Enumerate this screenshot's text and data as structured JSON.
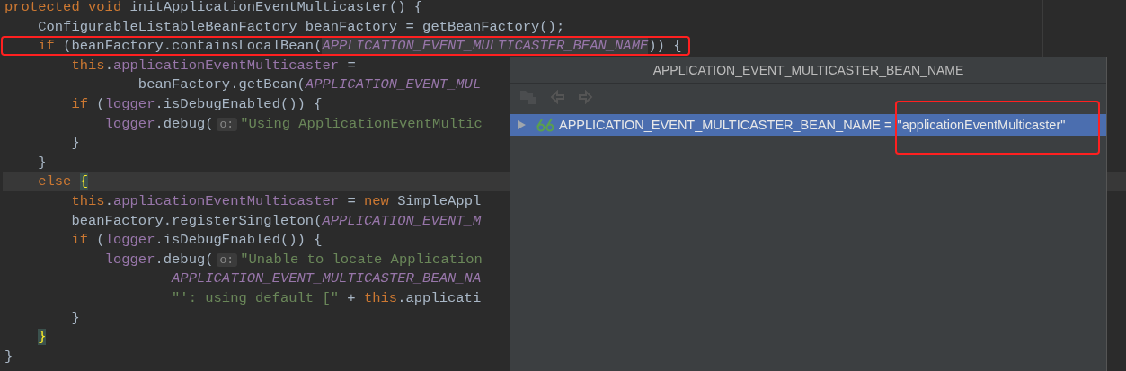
{
  "editor": {
    "lines": [
      {
        "current": false,
        "outlined": false,
        "tokens": [
          {
            "kind": "keyword",
            "text": "protected void "
          },
          {
            "kind": "plain",
            "text": "initApplicationEventMulticaster() {"
          }
        ]
      },
      {
        "current": false,
        "outlined": false,
        "tokens": [
          {
            "kind": "plain",
            "text": "    ConfigurableListableBeanFactory beanFactory = getBeanFactory();"
          }
        ]
      },
      {
        "current": false,
        "outlined": true,
        "tokens": [
          {
            "kind": "keyword",
            "text": "    if "
          },
          {
            "kind": "plain",
            "text": "(beanFactory.containsLocalBean("
          },
          {
            "kind": "const_hl",
            "text": "APPLICATION_EVENT_MULTICASTER_BEAN_NAME"
          },
          {
            "kind": "plain",
            "text": ")) {"
          }
        ]
      },
      {
        "current": false,
        "outlined": false,
        "tokens": [
          {
            "kind": "keyword",
            "text": "        this"
          },
          {
            "kind": "plain",
            "text": "."
          },
          {
            "kind": "field",
            "text": "applicationEventMulticaster"
          },
          {
            "kind": "plain",
            "text": " ="
          }
        ]
      },
      {
        "current": false,
        "outlined": false,
        "tokens": [
          {
            "kind": "plain",
            "text": "                beanFactory.getBean("
          },
          {
            "kind": "const",
            "text": "APPLICATION_EVENT_MUL"
          }
        ]
      },
      {
        "current": false,
        "outlined": false,
        "tokens": [
          {
            "kind": "keyword",
            "text": "        if "
          },
          {
            "kind": "plain",
            "text": "("
          },
          {
            "kind": "field",
            "text": "logger"
          },
          {
            "kind": "plain",
            "text": ".isDebugEnabled()) {"
          }
        ]
      },
      {
        "current": false,
        "outlined": false,
        "tokens": [
          {
            "kind": "field",
            "text": "            logger"
          },
          {
            "kind": "plain",
            "text": ".debug("
          },
          {
            "kind": "hint",
            "text": "o:"
          },
          {
            "kind": "string",
            "text": "\"Using ApplicationEventMultic"
          }
        ]
      },
      {
        "current": false,
        "outlined": false,
        "tokens": [
          {
            "kind": "plain",
            "text": "        }"
          }
        ]
      },
      {
        "current": false,
        "outlined": false,
        "tokens": [
          {
            "kind": "plain",
            "text": "    }"
          }
        ]
      },
      {
        "current": true,
        "outlined": false,
        "tokens": [
          {
            "kind": "keyword",
            "text": "    else "
          },
          {
            "kind": "brace_match",
            "text": "{"
          }
        ]
      },
      {
        "current": false,
        "outlined": false,
        "tokens": [
          {
            "kind": "keyword",
            "text": "        this"
          },
          {
            "kind": "plain",
            "text": "."
          },
          {
            "kind": "field",
            "text": "applicationEventMulticaster"
          },
          {
            "kind": "plain",
            "text": " = "
          },
          {
            "kind": "keyword",
            "text": "new "
          },
          {
            "kind": "plain",
            "text": "SimpleAppl"
          }
        ]
      },
      {
        "current": false,
        "outlined": false,
        "tokens": [
          {
            "kind": "plain",
            "text": "        beanFactory.registerSingleton("
          },
          {
            "kind": "const",
            "text": "APPLICATION_EVENT_M"
          }
        ]
      },
      {
        "current": false,
        "outlined": false,
        "tokens": [
          {
            "kind": "keyword",
            "text": "        if "
          },
          {
            "kind": "plain",
            "text": "("
          },
          {
            "kind": "field",
            "text": "logger"
          },
          {
            "kind": "plain",
            "text": ".isDebugEnabled()) {"
          }
        ]
      },
      {
        "current": false,
        "outlined": false,
        "tokens": [
          {
            "kind": "field",
            "text": "            logger"
          },
          {
            "kind": "plain",
            "text": ".debug("
          },
          {
            "kind": "hint",
            "text": "o:"
          },
          {
            "kind": "string",
            "text": "\"Unable to locate Application"
          }
        ]
      },
      {
        "current": false,
        "outlined": false,
        "tokens": [
          {
            "kind": "const",
            "text": "                    APPLICATION_EVENT_MULTICASTER_BEAN_NA"
          }
        ]
      },
      {
        "current": false,
        "outlined": false,
        "tokens": [
          {
            "kind": "string",
            "text": "                    \"': using default [\""
          },
          {
            "kind": "plain",
            "text": " + "
          },
          {
            "kind": "keyword",
            "text": "this"
          },
          {
            "kind": "plain",
            "text": ".applicati"
          }
        ]
      },
      {
        "current": false,
        "outlined": false,
        "tokens": [
          {
            "kind": "plain",
            "text": "        }"
          }
        ]
      },
      {
        "current": false,
        "outlined": false,
        "tokens": [
          {
            "kind": "brace_match",
            "text": "    }"
          }
        ]
      },
      {
        "current": false,
        "outlined": false,
        "tokens": [
          {
            "kind": "plain",
            "text": "}"
          }
        ]
      }
    ]
  },
  "popup": {
    "title": "APPLICATION_EVENT_MULTICASTER_BEAN_NAME",
    "rows": [
      {
        "selected": true,
        "expanded": false,
        "name": "APPLICATION_EVENT_MULTICASTER_BEAN_NAME",
        "separator": " = ",
        "value": "\"applicationEventMulticaster\"",
        "outlined": true
      }
    ]
  }
}
